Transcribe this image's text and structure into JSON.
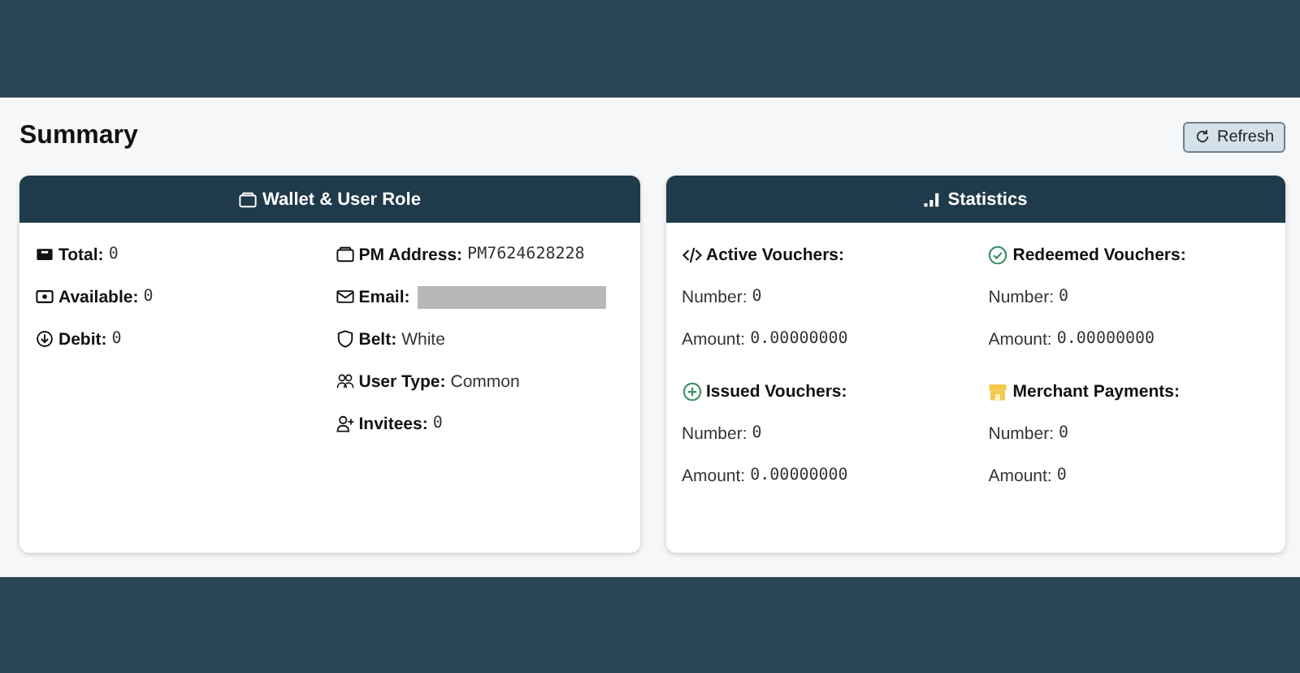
{
  "page": {
    "title": "Summary",
    "refresh_button": "Refresh"
  },
  "wallet": {
    "title": "Wallet & User Role",
    "left": [
      {
        "kind": "total",
        "label": "Total:",
        "value": "0",
        "mono": true
      },
      {
        "kind": "available",
        "label": "Available:",
        "value": "0",
        "mono": true
      },
      {
        "kind": "debit",
        "label": "Debit:",
        "value": "0",
        "mono": true
      }
    ],
    "right": [
      {
        "kind": "wallet",
        "label": "PM Address:",
        "value": "PM7624628228",
        "mono": true
      },
      {
        "kind": "email",
        "label": "Email:",
        "redacted": true
      },
      {
        "kind": "shield",
        "label": "Belt:",
        "value": "White",
        "mono": false
      },
      {
        "kind": "people",
        "label": "User Type:",
        "value": "Common",
        "mono": false
      },
      {
        "kind": "invite",
        "label": "Invitees:",
        "value": "0",
        "mono": true
      }
    ]
  },
  "statistics": {
    "title": "Statistics",
    "groups": [
      {
        "kind": "code",
        "title": "Active Vouchers:",
        "lines": [
          {
            "label": "Number:",
            "value": "0"
          },
          {
            "label": "Amount:",
            "value": "0.00000000"
          }
        ]
      },
      {
        "kind": "check",
        "title": "Redeemed Vouchers:",
        "lines": [
          {
            "label": "Number:",
            "value": "0"
          },
          {
            "label": "Amount:",
            "value": "0.00000000"
          }
        ]
      },
      {
        "kind": "plus",
        "title": "Issued Vouchers:",
        "lines": [
          {
            "label": "Number:",
            "value": "0"
          },
          {
            "label": "Amount:",
            "value": "0.00000000"
          }
        ]
      },
      {
        "kind": "shop",
        "title": "Merchant Payments:",
        "lines": [
          {
            "label": "Number:",
            "value": "0"
          },
          {
            "label": "Amount:",
            "value": "0"
          }
        ]
      }
    ]
  }
}
